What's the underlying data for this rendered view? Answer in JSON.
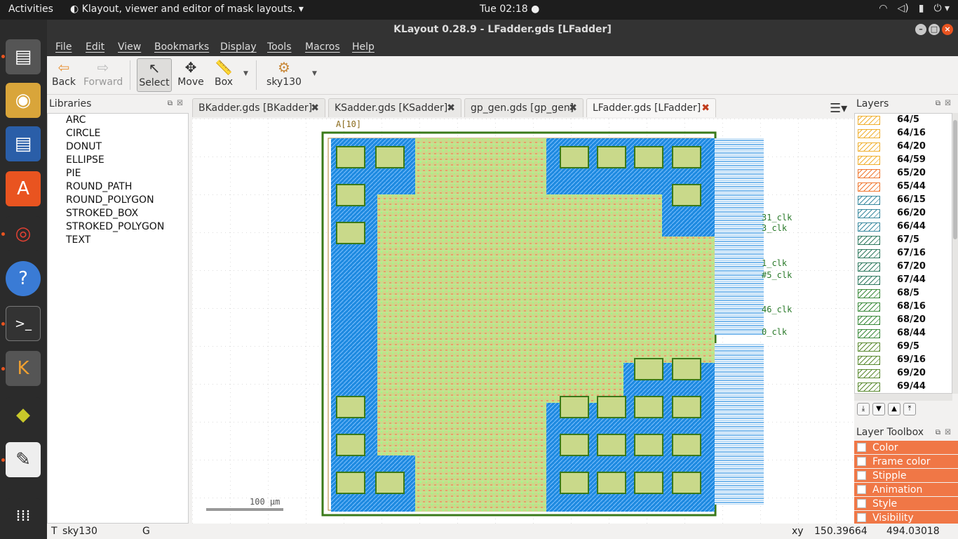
{
  "topbar": {
    "activities": "Activities",
    "app_name": "Klayout, viewer and editor of mask layouts.",
    "clock": "Tue 02:18"
  },
  "dock": {
    "items": [
      "files-icon",
      "rhythmbox-icon",
      "writer-icon",
      "software-center-icon",
      "chrome-icon",
      "help-icon",
      "terminal-icon",
      "klayout-icon",
      "xilinx-icon",
      "text-editor-icon",
      "apps-grid-icon"
    ]
  },
  "window": {
    "title": "KLayout 0.28.9 - LFadder.gds [LFadder]"
  },
  "menu": [
    "File",
    "Edit",
    "View",
    "Bookmarks",
    "Display",
    "Tools",
    "Macros",
    "Help"
  ],
  "toolbar": {
    "back": "Back",
    "forward": "Forward",
    "select": "Select",
    "move": "Move",
    "box": "Box",
    "tech": "sky130"
  },
  "libraries": {
    "title": "Libraries",
    "items": [
      "ARC",
      "CIRCLE",
      "DONUT",
      "ELLIPSE",
      "PIE",
      "ROUND_PATH",
      "ROUND_POLYGON",
      "STROKED_BOX",
      "STROKED_POLYGON",
      "TEXT"
    ]
  },
  "tabs": [
    {
      "label": "BKadder.gds [BKadder]",
      "active": false
    },
    {
      "label": "KSadder.gds [KSadder]",
      "active": false
    },
    {
      "label": "gp_gen.gds [gp_gen]",
      "active": false
    },
    {
      "label": "LFadder.gds [LFadder]",
      "active": true
    }
  ],
  "canvas": {
    "scale_label": "100 µm",
    "labels_top": "A[10]",
    "labels_right": [
      "31_clk",
      "3_clk",
      "1_clk",
      "#5_clk",
      "46_clk",
      "0_clk"
    ]
  },
  "layers": {
    "title": "Layers",
    "items": [
      {
        "name": "64/5",
        "color": "#f0b030"
      },
      {
        "name": "64/16",
        "color": "#f0b030"
      },
      {
        "name": "64/20",
        "color": "#f0b030"
      },
      {
        "name": "64/59",
        "color": "#f0b030"
      },
      {
        "name": "65/20",
        "color": "#f07830"
      },
      {
        "name": "65/44",
        "color": "#f07830"
      },
      {
        "name": "66/15",
        "color": "#3a8aa0"
      },
      {
        "name": "66/20",
        "color": "#3a8aa0"
      },
      {
        "name": "66/44",
        "color": "#3a8aa0"
      },
      {
        "name": "67/5",
        "color": "#307a60"
      },
      {
        "name": "67/16",
        "color": "#307a60"
      },
      {
        "name": "67/20",
        "color": "#307a60"
      },
      {
        "name": "67/44",
        "color": "#307a60"
      },
      {
        "name": "68/5",
        "color": "#3a8a3a"
      },
      {
        "name": "68/16",
        "color": "#3a8a3a"
      },
      {
        "name": "68/20",
        "color": "#3a8a3a"
      },
      {
        "name": "68/44",
        "color": "#3a8a3a"
      },
      {
        "name": "69/5",
        "color": "#5a8a30"
      },
      {
        "name": "69/16",
        "color": "#5a8a30"
      },
      {
        "name": "69/20",
        "color": "#5a8a30"
      },
      {
        "name": "69/44",
        "color": "#5a8a30"
      }
    ]
  },
  "toolbox": {
    "title": "Layer Toolbox",
    "items": [
      "Color",
      "Frame color",
      "Stipple",
      "Animation",
      "Style",
      "Visibility"
    ]
  },
  "status": {
    "t_label": "T",
    "tech": "sky130",
    "g_label": "G",
    "xy_label": "xy",
    "x": "150.39664",
    "y": "494.03018"
  }
}
